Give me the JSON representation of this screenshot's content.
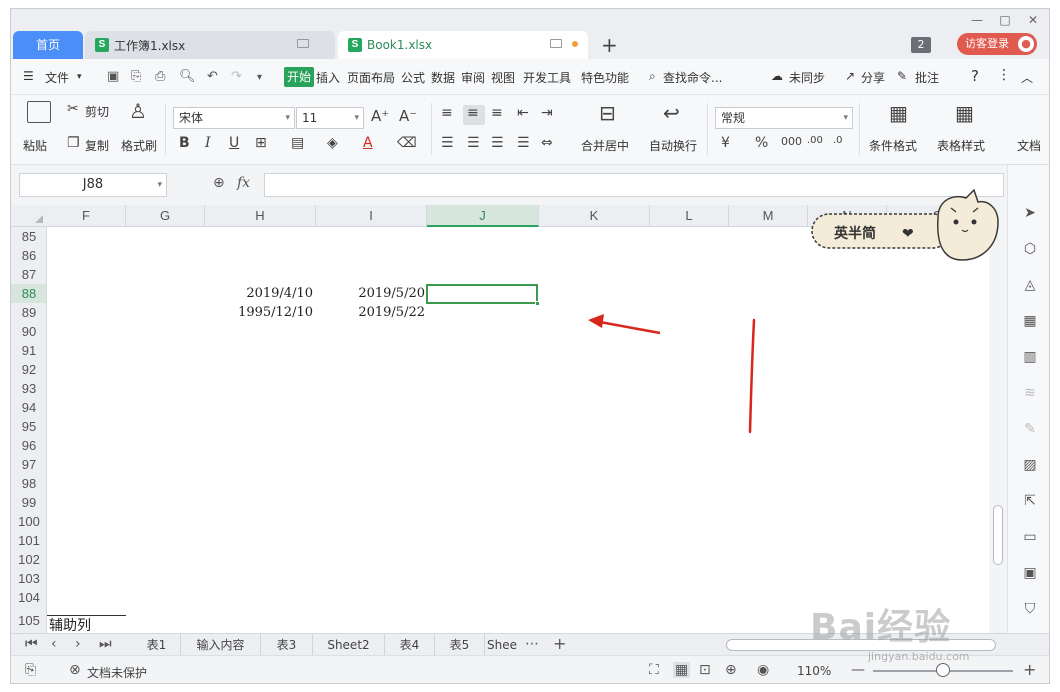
{
  "tabs": {
    "home": "首页",
    "doc1": "工作簿1.xlsx",
    "doc2": "Book1.xlsx",
    "badge": "2",
    "login": "访客登录"
  },
  "menu": {
    "file": "文件",
    "start": "开始",
    "insert": "插入",
    "layout": "页面布局",
    "formula": "公式",
    "data": "数据",
    "review": "审阅",
    "view": "视图",
    "dev": "开发工具",
    "special": "特色功能",
    "search": "查找命令...",
    "sync": "未同步",
    "share": "分享",
    "comment": "批注",
    "help": "?"
  },
  "ribbon": {
    "paste": "粘贴",
    "cut": "剪切",
    "copy": "复制",
    "format_painter": "格式刷",
    "font_name": "宋体",
    "font_size": "11",
    "bold": "B",
    "italic": "I",
    "underline": "U",
    "merge": "合并居中",
    "wrap": "自动换行",
    "number_format": "常规",
    "percent": "%",
    "cond_format": "条件格式",
    "table_style": "表格样式",
    "doc_label": "文档"
  },
  "formula_bar": {
    "name_box": "J88",
    "fx": "fx",
    "formula": ""
  },
  "columns": [
    {
      "name": "F",
      "active": false
    },
    {
      "name": "G",
      "active": false
    },
    {
      "name": "H",
      "active": false
    },
    {
      "name": "I",
      "active": false
    },
    {
      "name": "J",
      "active": true
    },
    {
      "name": "K",
      "active": false
    },
    {
      "name": "L",
      "active": false
    },
    {
      "name": "M",
      "active": false
    },
    {
      "name": "N",
      "active": false
    },
    {
      "name": "O",
      "active": false
    }
  ],
  "rows": [
    "85",
    "86",
    "87",
    "88",
    "89",
    "90",
    "91",
    "92",
    "93",
    "94",
    "95",
    "96",
    "97",
    "98",
    "99",
    "100",
    "101",
    "102",
    "103",
    "104",
    "105"
  ],
  "active_row": "88",
  "cells": {
    "h88": "2019/4/10",
    "i88": "2019/5/20",
    "h89": "1995/12/10",
    "i89": "2019/5/22",
    "f105": "辅助列"
  },
  "sheet_tabs": [
    "表1",
    "输入内容",
    "表3",
    "Sheet2",
    "表4",
    "表5",
    "Shee"
  ],
  "status": {
    "protect": "文档未保护",
    "zoom": "110%"
  },
  "sticker_text": "英半简",
  "watermark": "Bai经验",
  "watermark_sub": "jingyan.baidu.com",
  "colors": {
    "accent_green": "#2aa35a",
    "home_tab_blue": "#4c8ef7",
    "login_red": "#e05a4f",
    "annotation_red": "#d9261c"
  }
}
